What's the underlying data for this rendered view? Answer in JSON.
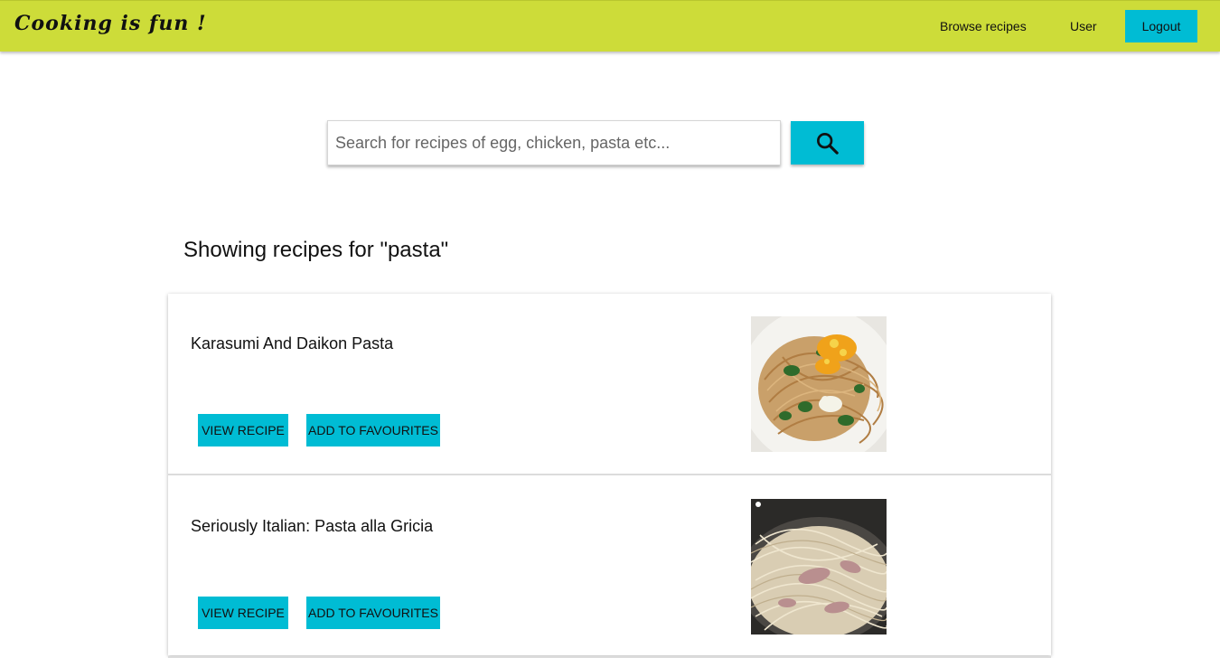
{
  "navbar": {
    "brand": "Cooking is fun !",
    "links": {
      "browse": "Browse recipes",
      "user": "User"
    },
    "logout_label": "Logout",
    "color": "#cddc39"
  },
  "search": {
    "placeholder": "Search for recipes of egg, chicken, pasta etc...",
    "value": "",
    "button_icon": "search-icon"
  },
  "results": {
    "heading": "Showing recipes for \"pasta\"",
    "items": [
      {
        "title": "Karasumi And Daikon Pasta",
        "view_label": "VIEW RECIPE",
        "fav_label": "ADD TO FAVOURITES",
        "image": "pasta-with-greens-and-grated-karasumi"
      },
      {
        "title": "Seriously Italian: Pasta alla Gricia",
        "view_label": "VIEW RECIPE",
        "fav_label": "ADD TO FAVOURITES",
        "image": "spaghetti-with-guanciale-in-pan"
      }
    ]
  },
  "colors": {
    "accent": "#00bcd4",
    "navbar": "#cddc39"
  }
}
